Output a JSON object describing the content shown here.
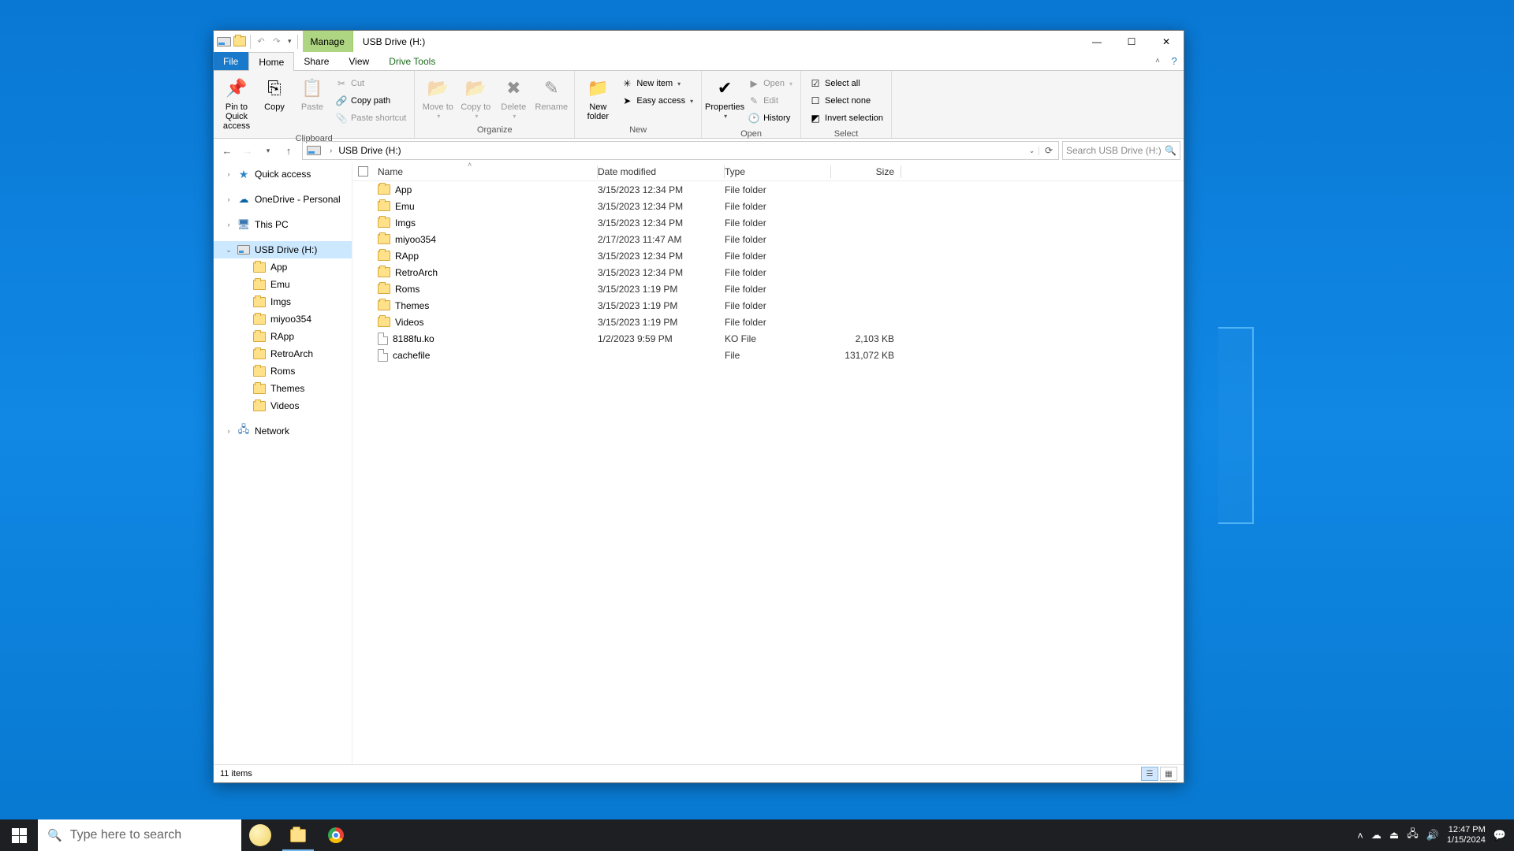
{
  "window": {
    "context_tab": "Manage",
    "title": "USB Drive (H:)",
    "tabs": {
      "file": "File",
      "home": "Home",
      "share": "Share",
      "view": "View",
      "drive_tools": "Drive Tools"
    }
  },
  "ribbon": {
    "clipboard": {
      "label": "Clipboard",
      "pin": "Pin to Quick access",
      "copy": "Copy",
      "paste": "Paste",
      "cut": "Cut",
      "copy_path": "Copy path",
      "paste_shortcut": "Paste shortcut"
    },
    "organize": {
      "label": "Organize",
      "move_to": "Move to",
      "copy_to": "Copy to",
      "delete": "Delete",
      "rename": "Rename"
    },
    "new": {
      "label": "New",
      "new_folder": "New folder",
      "new_item": "New item",
      "easy_access": "Easy access"
    },
    "open": {
      "label": "Open",
      "properties": "Properties",
      "open": "Open",
      "edit": "Edit",
      "history": "History"
    },
    "select": {
      "label": "Select",
      "select_all": "Select all",
      "select_none": "Select none",
      "invert": "Invert selection"
    }
  },
  "addressbar": {
    "location": "USB Drive (H:)",
    "search_placeholder": "Search USB Drive (H:)"
  },
  "nav": {
    "quick_access": "Quick access",
    "onedrive": "OneDrive - Personal",
    "this_pc": "This PC",
    "usb": "USB Drive (H:)",
    "usb_children": [
      "App",
      "Emu",
      "Imgs",
      "miyoo354",
      "RApp",
      "RetroArch",
      "Roms",
      "Themes",
      "Videos"
    ],
    "network": "Network"
  },
  "columns": {
    "name": "Name",
    "date": "Date modified",
    "type": "Type",
    "size": "Size"
  },
  "rows": [
    {
      "icon": "folder",
      "name": "App",
      "date": "3/15/2023 12:34 PM",
      "type": "File folder",
      "size": ""
    },
    {
      "icon": "folder",
      "name": "Emu",
      "date": "3/15/2023 12:34 PM",
      "type": "File folder",
      "size": ""
    },
    {
      "icon": "folder",
      "name": "Imgs",
      "date": "3/15/2023 12:34 PM",
      "type": "File folder",
      "size": ""
    },
    {
      "icon": "folder",
      "name": "miyoo354",
      "date": "2/17/2023 11:47 AM",
      "type": "File folder",
      "size": ""
    },
    {
      "icon": "folder",
      "name": "RApp",
      "date": "3/15/2023 12:34 PM",
      "type": "File folder",
      "size": ""
    },
    {
      "icon": "folder",
      "name": "RetroArch",
      "date": "3/15/2023 12:34 PM",
      "type": "File folder",
      "size": ""
    },
    {
      "icon": "folder",
      "name": "Roms",
      "date": "3/15/2023 1:19 PM",
      "type": "File folder",
      "size": ""
    },
    {
      "icon": "folder",
      "name": "Themes",
      "date": "3/15/2023 1:19 PM",
      "type": "File folder",
      "size": ""
    },
    {
      "icon": "folder",
      "name": "Videos",
      "date": "3/15/2023 1:19 PM",
      "type": "File folder",
      "size": ""
    },
    {
      "icon": "file",
      "name": "8188fu.ko",
      "date": "1/2/2023 9:59 PM",
      "type": "KO File",
      "size": "2,103 KB"
    },
    {
      "icon": "file",
      "name": "cachefile",
      "date": "",
      "type": "File",
      "size": "131,072 KB"
    }
  ],
  "status": {
    "count": "11 items"
  },
  "taskbar": {
    "search_placeholder": "Type here to search",
    "time": "12:47 PM",
    "date": "1/15/2024"
  }
}
